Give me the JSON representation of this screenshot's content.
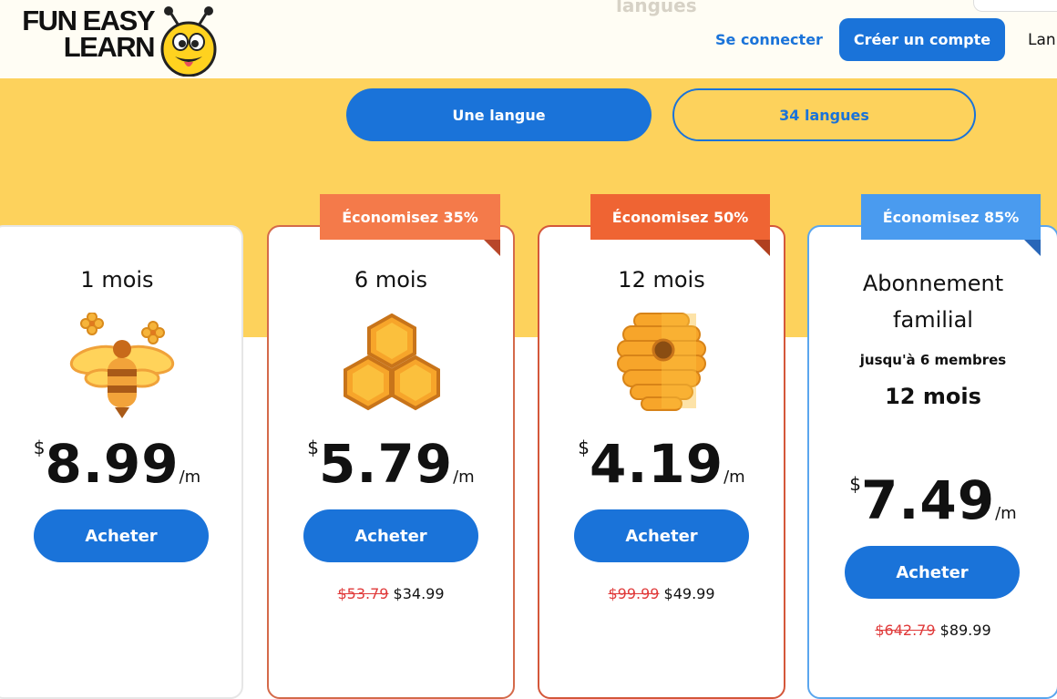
{
  "header": {
    "logo_line1": "FUN EASY",
    "logo_line2": "LEARN",
    "ghost_text": "langues",
    "login_label": "Se connecter",
    "signup_label": "Créer un compte",
    "language_cut": "Lan"
  },
  "toggle": {
    "one": "Une langue",
    "all": "34 langues"
  },
  "plans": [
    {
      "title": "1 mois",
      "currency": "$",
      "price": "8.99",
      "per": "/m",
      "buy": "Acheter",
      "icon": "bee-icon"
    },
    {
      "title": "6 mois",
      "ribbon": "Économisez 35%",
      "currency": "$",
      "price": "5.79",
      "per": "/m",
      "buy": "Acheter",
      "old": "$53.79",
      "new": "$34.99",
      "icon": "honeycomb-icon"
    },
    {
      "title": "12 mois",
      "ribbon": "Économisez 50%",
      "currency": "$",
      "price": "4.19",
      "per": "/m",
      "buy": "Acheter",
      "old": "$99.99",
      "new": "$49.99",
      "icon": "beehive-icon"
    },
    {
      "title_line1": "Abonnement",
      "title_line2": "familial",
      "members": "jusqu'à 6 membres",
      "duration": "12 mois",
      "ribbon": "Économisez 85%",
      "currency": "$",
      "price": "7.49",
      "per": "/m",
      "buy": "Acheter",
      "old": "$642.79",
      "new": "$89.99"
    }
  ],
  "colors": {
    "accent": "#1a73d9",
    "yellow": "#fdd25c",
    "ribbon_35": "#f47a4a",
    "ribbon_50": "#ef6433",
    "ribbon_85": "#4a9bef",
    "strike": "#e03a3a"
  }
}
